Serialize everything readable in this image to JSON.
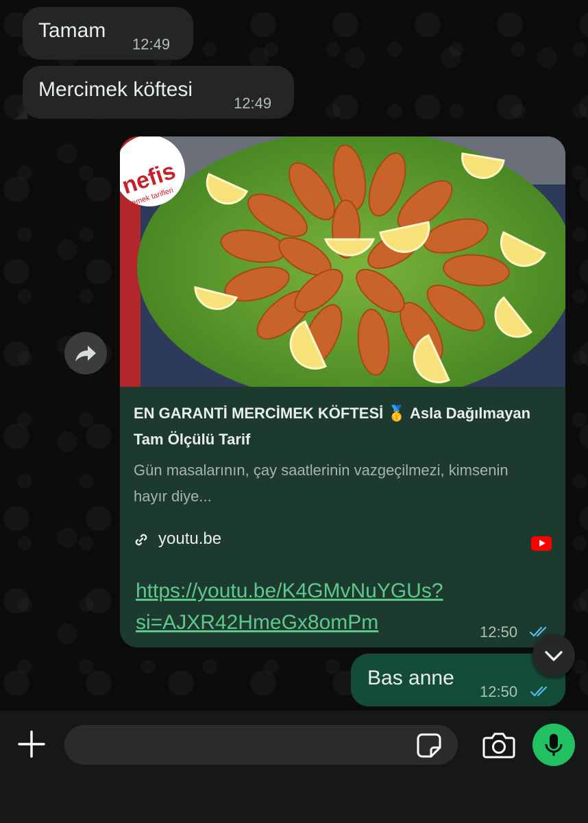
{
  "messages": [
    {
      "text": "Tamam",
      "time": "12:49"
    },
    {
      "text": "Mercimek köftesi",
      "time": "12:49"
    }
  ],
  "link_preview": {
    "brand_logo_text": "nefis",
    "brand_logo_subtext": "yemek tarifleri",
    "title": "EN GARANTİ MERCİMEK KÖFTESİ 🥇 Asla Dağılmayan Tam Ölçülü Tarif",
    "description": "Gün masalarının, çay saatlerinin vazgeçilmezi, kimsenin hayır diye...",
    "domain": "youtu.be",
    "url_line1": "https://youtu.be/K4GMvNuYGUs?",
    "url_line2": "si=AJXR42HmeGx8omPm",
    "time": "12:50",
    "status": "read"
  },
  "outgoing": {
    "text": "Bas anne",
    "time": "12:50",
    "status": "read"
  },
  "icons": {
    "forward": "forward-icon",
    "scroll": "chevron-down-icon",
    "attach": "plus-icon",
    "sticker": "sticker-icon",
    "camera": "camera-icon",
    "mic": "microphone-icon",
    "link": "link-icon",
    "youtube": "youtube-icon"
  },
  "colors": {
    "incoming_bubble": "#242626",
    "outgoing_bubble": "#144d37",
    "preview_body": "#1d3a2e",
    "link": "#5ec98f",
    "read_ticks": "#53bdeb",
    "mic_button": "#21c063"
  }
}
